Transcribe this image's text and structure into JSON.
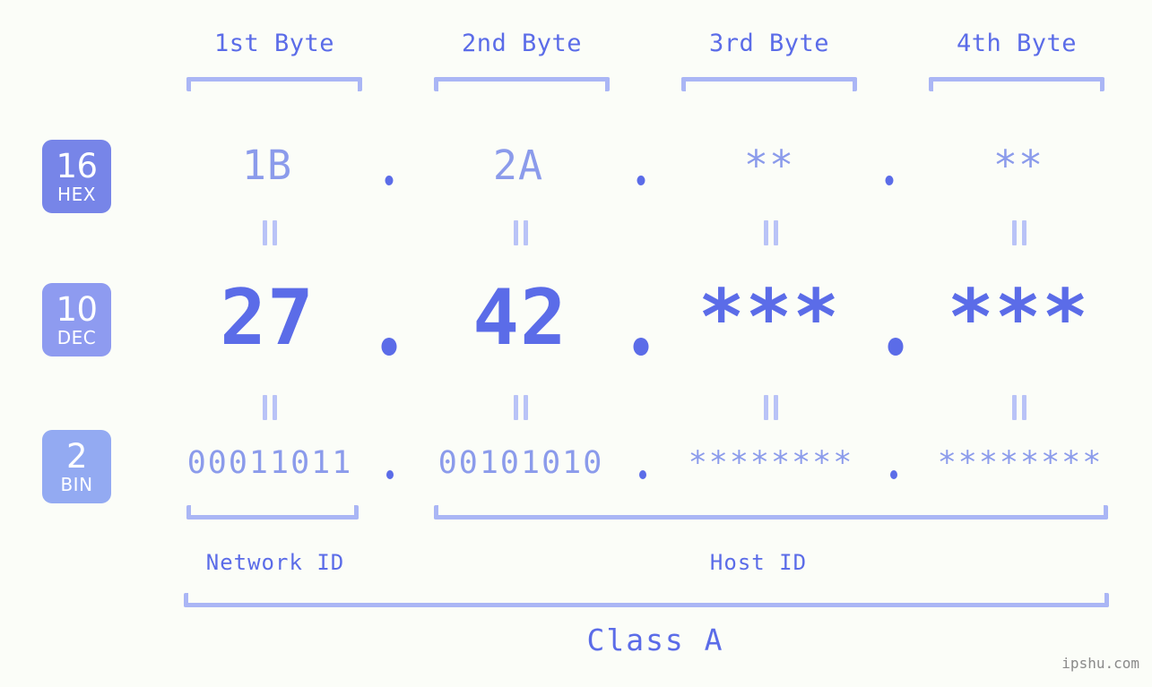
{
  "background_color": "#fbfdf8",
  "accent_color": "#5b6ce8",
  "accent_light_color": "#8b9beb",
  "bracket_color": "#aab6f5",
  "watermark": "ipshu.com",
  "byte_headers": [
    {
      "label": "1st Byte"
    },
    {
      "label": "2nd Byte"
    },
    {
      "label": "3rd Byte"
    },
    {
      "label": "4th Byte"
    }
  ],
  "bases": [
    {
      "number": "16",
      "name": "HEX",
      "color": "#7785e8"
    },
    {
      "number": "10",
      "name": "DEC",
      "color": "#8e9bf0"
    },
    {
      "number": "2",
      "name": "BIN",
      "color": "#93aaf2"
    }
  ],
  "rows": {
    "hex": {
      "values": [
        "1B",
        "2A",
        "**",
        "**"
      ],
      "separator": "."
    },
    "dec": {
      "values": [
        "27",
        "42",
        "***",
        "***"
      ],
      "separator": "."
    },
    "bin": {
      "values": [
        "00011011",
        "00101010",
        "********",
        "********"
      ],
      "separator": "."
    }
  },
  "equals_marks": {
    "symbol": "||",
    "count_per_row": 4
  },
  "sections": [
    {
      "label": "Network ID"
    },
    {
      "label": "Host ID"
    }
  ],
  "class": {
    "label": "Class A"
  },
  "chart_data": {
    "type": "table",
    "title": "Class A",
    "categories": [
      "1st Byte",
      "2nd Byte",
      "3rd Byte",
      "4th Byte"
    ],
    "series": [
      {
        "name": "HEX",
        "values": [
          "1B",
          "2A",
          "**",
          "**"
        ]
      },
      {
        "name": "DEC",
        "values": [
          "27",
          "42",
          "***",
          "***"
        ]
      },
      {
        "name": "BIN",
        "values": [
          "00011011",
          "00101010",
          "********",
          "********"
        ]
      }
    ],
    "groups": [
      {
        "name": "Network ID",
        "bytes": [
          "1st Byte"
        ]
      },
      {
        "name": "Host ID",
        "bytes": [
          "2nd Byte",
          "3rd Byte",
          "4th Byte"
        ]
      }
    ]
  }
}
